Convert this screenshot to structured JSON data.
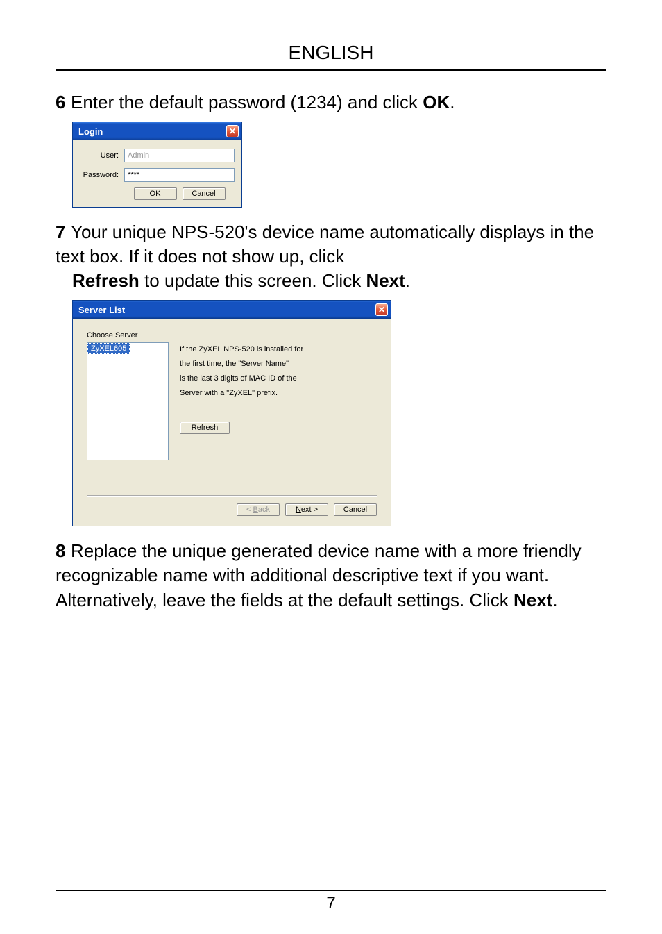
{
  "header": "ENGLISH",
  "step6": {
    "num": "6",
    "text_a": "Enter the default password (1234) and click ",
    "ok": "OK",
    "text_b": "."
  },
  "login": {
    "title": "Login",
    "close": "✕",
    "user_label": "User:",
    "user_value": "Admin",
    "password_label": "Password:",
    "password_value": "****",
    "ok_btn": "OK",
    "cancel_btn": "Cancel"
  },
  "step7": {
    "num": "7",
    "text_a": "Your unique NPS-520's device name automatically displays in the text box. If it does not show up, click ",
    "refresh": "Refresh",
    "text_b": " to update this screen. Click ",
    "next": "Next",
    "text_c": "."
  },
  "serverlist": {
    "title": "Server List",
    "close": "✕",
    "choose_label": "Choose Server",
    "item": "ZyXEL605",
    "desc_l1": "If the ZyXEL NPS-520 is installed for",
    "desc_l2": "the first time, the \"Server Name\"",
    "desc_l3": "is the last 3 digits of MAC ID of the",
    "desc_l4": "Server with a \"ZyXEL\" prefix.",
    "refresh_r": "R",
    "refresh_rest": "efresh",
    "back_lt": "< ",
    "back_b": "B",
    "back_rest": "ack",
    "next_n": "N",
    "next_rest": "ext >",
    "cancel": "Cancel"
  },
  "step8": {
    "num": "8",
    "text_a": "Replace the unique generated device name with a more friendly recognizable name with additional descriptive text if you want. Alternatively, leave the fields at the default settings. Click ",
    "next": "Next",
    "text_b": "."
  },
  "page_number": "7"
}
